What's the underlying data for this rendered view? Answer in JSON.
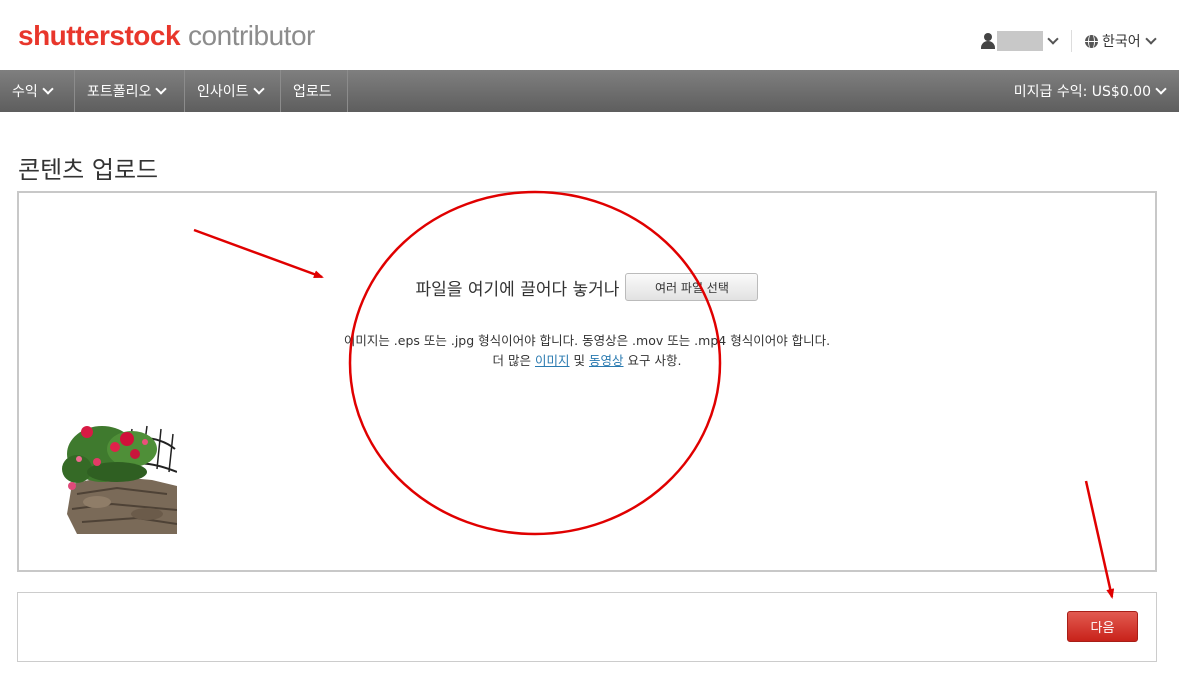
{
  "header": {
    "logo_main": "shutterstock",
    "logo_sub": "contributor",
    "language": "한국어"
  },
  "nav": {
    "items": [
      "수익",
      "포트폴리오",
      "인사이트",
      "업로드"
    ],
    "earnings": "미지급 수익: US$0.00"
  },
  "page": {
    "title": "콘텐츠 업로드"
  },
  "upload": {
    "drop_text": "파일을 여기에 끌어다 놓거나",
    "select_button": "여러 파일 선택",
    "info_line1": "이미지는 .eps 또는 .jpg 형식이어야 합니다. 동영상은 .mov 또는 .mp4 형식이어야 합니다.",
    "info_prefix": "더 많은",
    "link_images": "이미지",
    "info_and": "및",
    "link_videos": "동영상",
    "info_suffix": "요구 사항."
  },
  "footer": {
    "next_button": "다음"
  },
  "colors": {
    "brand_red": "#e8362b",
    "nav_gray": "#6e6e6e",
    "annotation_red": "#e00000",
    "link_blue": "#2a7ab0"
  }
}
